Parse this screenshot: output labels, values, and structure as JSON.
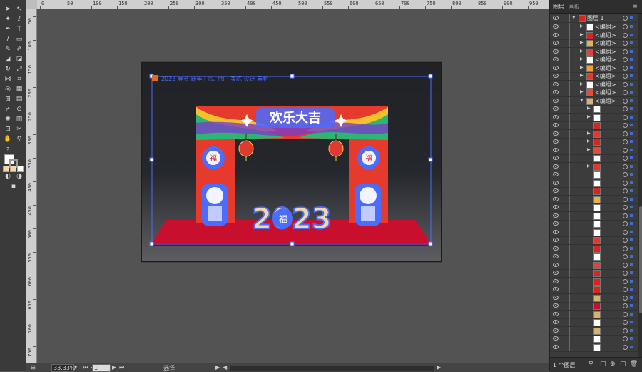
{
  "ruler": {
    "top_labels": [
      "0",
      "50",
      "100",
      "150",
      "200",
      "250",
      "300",
      "350",
      "400",
      "450",
      "500",
      "550",
      "600",
      "650",
      "700",
      "750",
      "800",
      "850",
      "900",
      "950"
    ],
    "left_labels": [
      "50",
      "100",
      "150",
      "200",
      "250",
      "300",
      "350",
      "400",
      "450",
      "500",
      "550",
      "600",
      "650",
      "700",
      "750"
    ]
  },
  "artwork": {
    "title_text": "欢乐大吉",
    "year_text": "2023",
    "fu_char": "福",
    "header_note": "2023 春节 新年 门头 拱门 美陈 设计 素材"
  },
  "status": {
    "zoom": "33.33%",
    "page": "1",
    "mode": "选择"
  },
  "layers_panel": {
    "tab_layers": "图层",
    "tab_artboards": "画板",
    "top_layer_name": "图层 1",
    "group_label": "<编组>",
    "footer_count": "1 个图层",
    "rows": [
      {
        "label": "<编组>",
        "thumb": "#ffffff"
      },
      {
        "label": "<编组>",
        "thumb": "#d7261e"
      },
      {
        "label": "<编组>",
        "thumb": "#e9b14b"
      },
      {
        "label": "<编组>",
        "thumb": "#e2413a"
      },
      {
        "label": "<编组>",
        "thumb": "#ffffff"
      },
      {
        "label": "<编组>",
        "thumb": "#f0a030"
      },
      {
        "label": "<编组>",
        "thumb": "#e03a30"
      },
      {
        "label": "<编组>",
        "thumb": "#ffffff"
      },
      {
        "label": "<编组>",
        "thumb": "#e84a35"
      },
      {
        "label": "<编组>",
        "thumb": "#d9b16a"
      }
    ]
  },
  "colors": {
    "accent": "#3f6cd8",
    "selection": "#4a6cff",
    "arch_red": "#e63a2c",
    "carpet": "#c8102e"
  }
}
